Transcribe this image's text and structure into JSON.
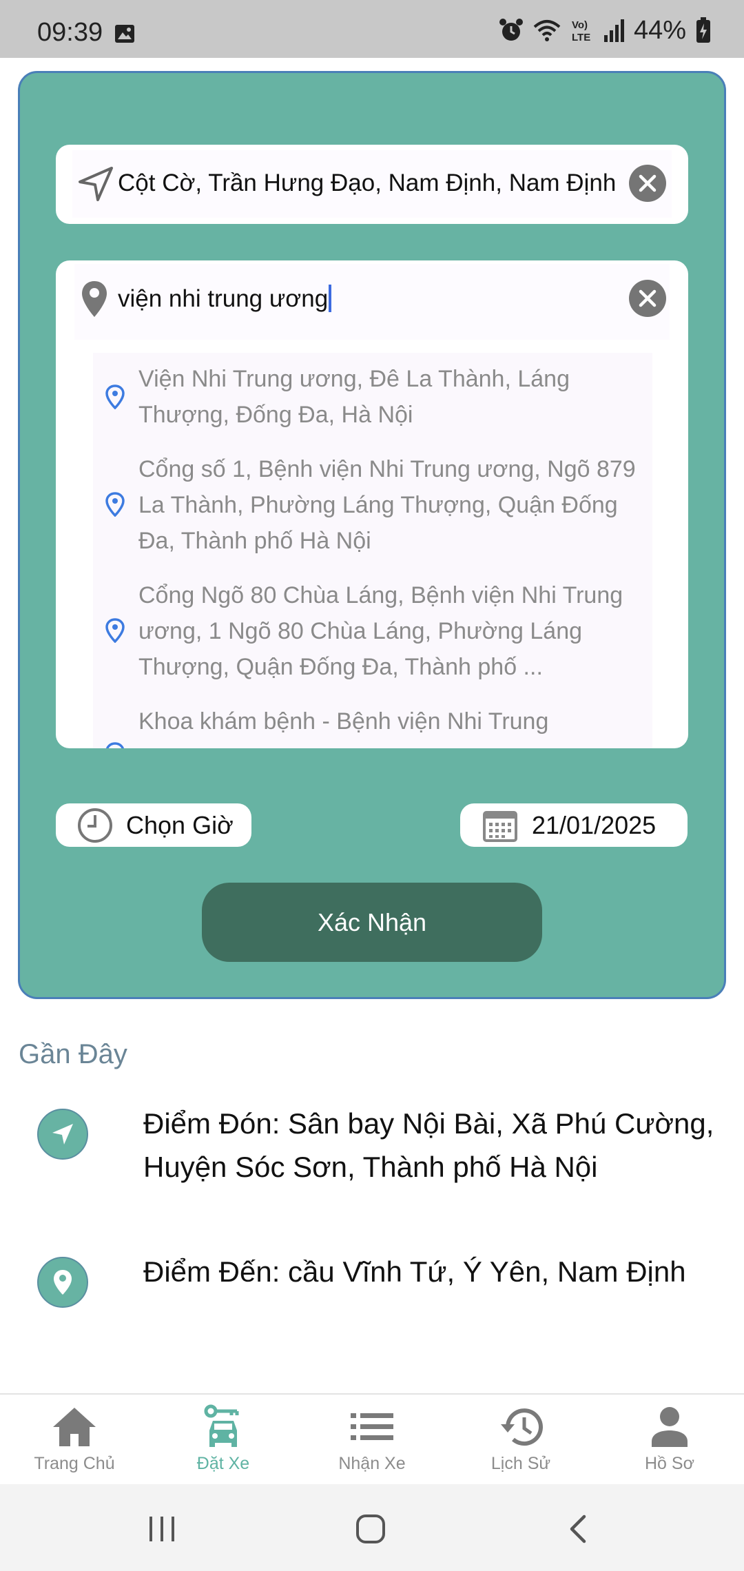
{
  "status_bar": {
    "time": "09:39",
    "battery": "44%"
  },
  "booking": {
    "pickup": {
      "value": "Cột Cờ, Trần Hưng Đạo, Nam Định, Nam Định"
    },
    "destination": {
      "value": "viện nhi trung ương"
    },
    "suggestions": [
      {
        "text": "Viện Nhi Trung ương, Đê La Thành, Láng Thượng, Đống Đa, Hà Nội"
      },
      {
        "text": "Cổng số 1, Bệnh viện Nhi Trung ương, Ngõ 879 La Thành, Phường Láng Thượng, Quận Đống Đa, Thành phố Hà Nội"
      },
      {
        "text": "Cổng Ngõ 80 Chùa Láng, Bệnh viện Nhi Trung ương, 1 Ngõ 80 Chùa Láng, Phường Láng Thượng, Quận Đống Đa, Thành phố ..."
      },
      {
        "text": "Khoa khám bệnh - Bệnh viện Nhi Trung"
      }
    ],
    "time_label": "Chọn Giờ",
    "date_label": "21/01/2025",
    "confirm_label": "Xác Nhận"
  },
  "recent": {
    "title": "Gần Đây",
    "items": [
      {
        "icon": "navigation-arrow-icon",
        "text": "Điểm Đón: Sân bay Nội Bài, Xã Phú Cường, Huyện Sóc Sơn, Thành phố Hà Nội"
      },
      {
        "icon": "location-pin-icon",
        "text": "Điểm Đến: cầu Vĩnh Tứ, Ý Yên, Nam Định"
      }
    ]
  },
  "bottom_nav": {
    "items": [
      {
        "label": "Trang Chủ",
        "icon": "home-icon"
      },
      {
        "label": "Đặt Xe",
        "icon": "car-key-icon",
        "active": true
      },
      {
        "label": "Nhận Xe",
        "icon": "list-icon"
      },
      {
        "label": "Lịch Sử",
        "icon": "history-icon"
      },
      {
        "label": "Hồ Sơ",
        "icon": "person-icon"
      }
    ]
  },
  "colors": {
    "card_bg": "#67b3a3",
    "card_border": "#4a7fb8",
    "confirm_bg": "#3f6e5e",
    "active_nav": "#5fb3a3",
    "pin_blue": "#3d7be0"
  }
}
